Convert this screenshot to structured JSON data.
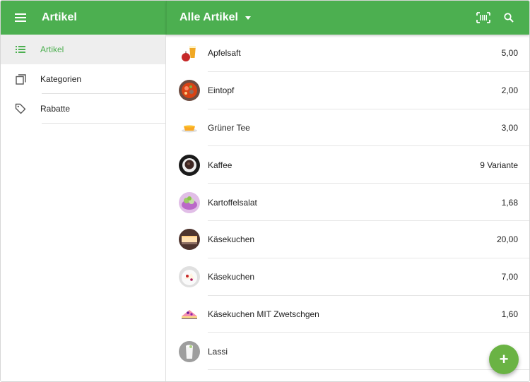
{
  "app": {
    "title": "Artikel"
  },
  "toolbar": {
    "filter_label": "Alle Artikel"
  },
  "sidebar": {
    "items": [
      {
        "label": "Artikel",
        "icon": "list-icon",
        "active": true
      },
      {
        "label": "Kategorien",
        "icon": "categories-icon",
        "active": false
      },
      {
        "label": "Rabatte",
        "icon": "tag-icon",
        "active": false
      }
    ]
  },
  "items": [
    {
      "name": "Apfelsaft",
      "price": "5,00",
      "icon": "apple-juice-thumbnail"
    },
    {
      "name": "Eintopf",
      "price": "2,00",
      "icon": "stew-thumbnail"
    },
    {
      "name": "Grüner Tee",
      "price": "3,00",
      "icon": "green-tea-thumbnail"
    },
    {
      "name": "Kaffee",
      "price": "9 Variante",
      "icon": "coffee-thumbnail"
    },
    {
      "name": "Kartoffelsalat",
      "price": "1,68",
      "icon": "potato-salad-thumbnail"
    },
    {
      "name": "Käsekuchen",
      "price": "20,00",
      "icon": "cheesecake-thumbnail"
    },
    {
      "name": "Käsekuchen",
      "price": "7,00",
      "icon": "cheesecake-thumbnail"
    },
    {
      "name": "Käsekuchen MIT Zwetschgen",
      "price": "1,60",
      "icon": "plum-cheesecake-thumbnail"
    },
    {
      "name": "Lassi",
      "price": "",
      "icon": "lassi-thumbnail"
    }
  ],
  "colors": {
    "primary": "#4caf50",
    "fab": "#6ab344",
    "active_bg": "#eeeeee"
  },
  "fab": {
    "icon": "plus-icon",
    "symbol": "+"
  }
}
